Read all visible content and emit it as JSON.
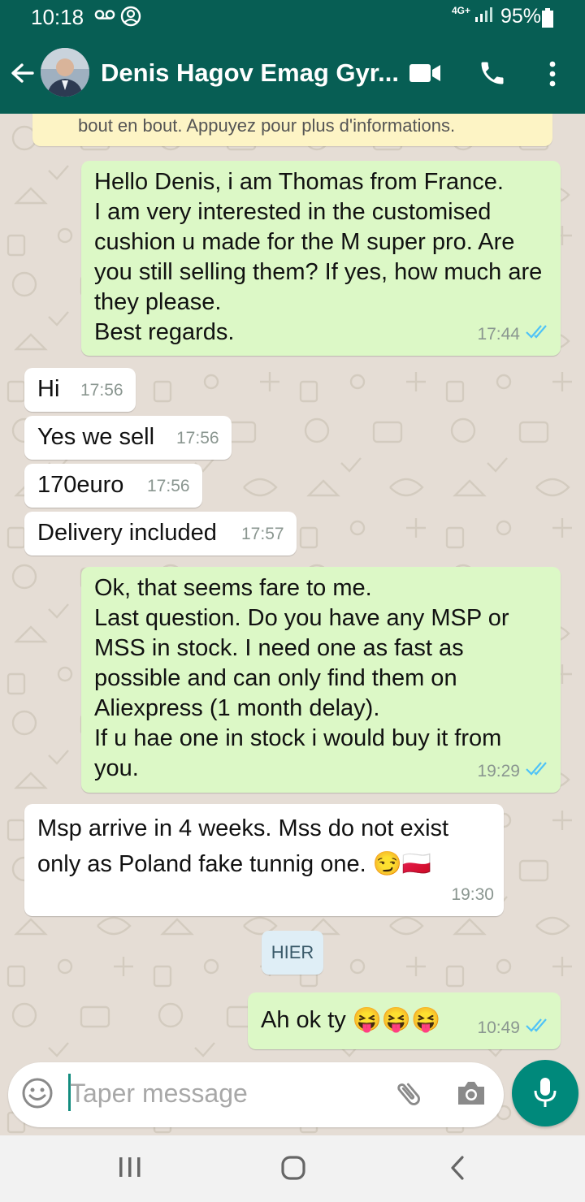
{
  "status_bar": {
    "time": "10:18",
    "network": "4G+",
    "battery": "95%",
    "icons": [
      "voicemail-icon",
      "account-circle-icon",
      "signal-icon",
      "battery-icon"
    ]
  },
  "header": {
    "contact_name": "Denis Hagov Emag Gyr...",
    "icons": [
      "back-arrow-icon",
      "video-call-icon",
      "phone-icon",
      "more-vert-icon"
    ]
  },
  "chat": {
    "encryption_notice": "bout en bout. Appuyez pour plus d'informations.",
    "messages": [
      {
        "dir": "out",
        "text": "Hello Denis, i am Thomas from France.\nI am very interested in the customised cushion u made for the M super pro. Are you still selling them? If yes, how much are they please.\nBest regards.",
        "time": "17:44",
        "read": true
      },
      {
        "dir": "in",
        "text": "Hi",
        "time": "17:56"
      },
      {
        "dir": "in",
        "text": "Yes we sell",
        "time": "17:56"
      },
      {
        "dir": "in",
        "text": "170euro",
        "time": "17:56"
      },
      {
        "dir": "in",
        "text": "Delivery included",
        "time": "17:57"
      },
      {
        "dir": "out",
        "text": "Ok, that seems fare to me.\nLast question. Do you have any MSP or MSS in stock. I need one as fast as possible and can only find them on Aliexpress (1 month delay).\nIf u hae one in stock i would buy it from you.",
        "time": "19:29",
        "read": true
      },
      {
        "dir": "in",
        "text": "Msp arrive in 4 weeks. Mss do not exist only as Poland fake tunnig one. 😏🇵🇱",
        "time": "19:30"
      },
      {
        "dir": "out",
        "text": "Ah ok ty 😝😝😝",
        "time": "10:49",
        "read": true
      }
    ],
    "date_divider": "HIER"
  },
  "composer": {
    "placeholder": "Taper message",
    "icons": [
      "emoji-icon",
      "attach-icon",
      "camera-icon",
      "mic-icon"
    ]
  },
  "colors": {
    "header": "#075e54",
    "outgoing_bubble": "#dcf8c6",
    "incoming_bubble": "#ffffff",
    "read_tick": "#4fc3f7",
    "mic_button": "#00897b"
  }
}
